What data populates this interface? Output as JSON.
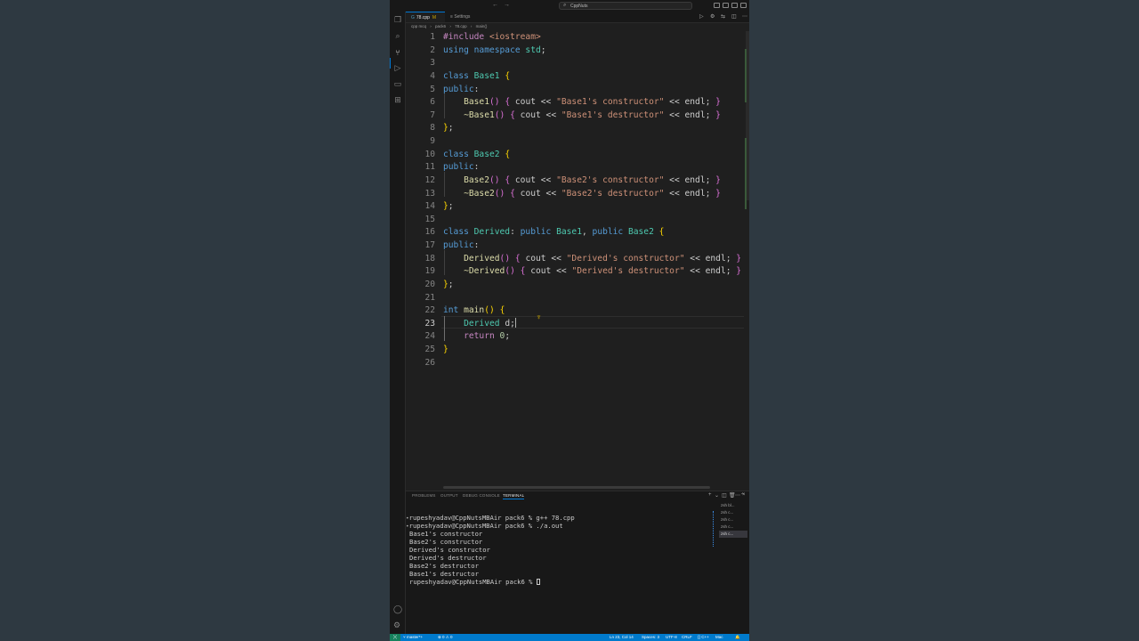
{
  "window": {
    "title": "CppNuts"
  },
  "tabs": [
    {
      "label": "78.cpp",
      "modified": "M",
      "active": true
    },
    {
      "label": "Settings",
      "active": false
    }
  ],
  "breadcrumb": [
    "cpp mcq",
    "pack6",
    "78.cpp",
    "main()"
  ],
  "editor": {
    "current_line": 23,
    "lines": [
      {
        "n": "1",
        "t": [
          [
            "inc",
            "#include "
          ],
          [
            "str",
            "<iostream>"
          ]
        ]
      },
      {
        "n": "2",
        "t": [
          [
            "kw",
            "using "
          ],
          [
            "kw",
            "namespace "
          ],
          [
            "cls",
            "std"
          ],
          [
            "",
            "; "
          ]
        ]
      },
      {
        "n": "3",
        "t": []
      },
      {
        "n": "4",
        "t": [
          [
            "kw",
            "class "
          ],
          [
            "cls",
            "Base1 "
          ],
          [
            "br1",
            "{"
          ]
        ]
      },
      {
        "n": "5",
        "t": [
          [
            "kw",
            "public"
          ],
          [
            "",
            ":"
          ]
        ]
      },
      {
        "n": "6",
        "t": [
          [
            "",
            "    "
          ],
          [
            "fn",
            "Base1"
          ],
          [
            "br2",
            "()"
          ],
          [
            "",
            " "
          ],
          [
            "br2",
            "{"
          ],
          [
            "",
            " cout << "
          ],
          [
            "str",
            "\"Base1's constructor\""
          ],
          [
            "",
            " << endl; "
          ],
          [
            "br2",
            "}"
          ]
        ]
      },
      {
        "n": "7",
        "t": [
          [
            "",
            "    "
          ],
          [
            "fn",
            "~Base1"
          ],
          [
            "br2",
            "()"
          ],
          [
            "",
            " "
          ],
          [
            "br2",
            "{"
          ],
          [
            "",
            " cout << "
          ],
          [
            "str",
            "\"Base1's destructor\""
          ],
          [
            "",
            " << endl; "
          ],
          [
            "br2",
            "}"
          ]
        ]
      },
      {
        "n": "8",
        "t": [
          [
            "br1",
            "}"
          ],
          [
            "",
            ";"
          ]
        ]
      },
      {
        "n": "9",
        "t": []
      },
      {
        "n": "10",
        "t": [
          [
            "kw",
            "class "
          ],
          [
            "cls",
            "Base2 "
          ],
          [
            "br1",
            "{"
          ]
        ]
      },
      {
        "n": "11",
        "t": [
          [
            "kw",
            "public"
          ],
          [
            "",
            ":"
          ]
        ]
      },
      {
        "n": "12",
        "t": [
          [
            "",
            "    "
          ],
          [
            "fn",
            "Base2"
          ],
          [
            "br2",
            "()"
          ],
          [
            "",
            " "
          ],
          [
            "br2",
            "{"
          ],
          [
            "",
            " cout << "
          ],
          [
            "str",
            "\"Base2's constructor\""
          ],
          [
            "",
            " << endl; "
          ],
          [
            "br2",
            "}"
          ]
        ]
      },
      {
        "n": "13",
        "t": [
          [
            "",
            "    "
          ],
          [
            "fn",
            "~Base2"
          ],
          [
            "br2",
            "()"
          ],
          [
            "",
            " "
          ],
          [
            "br2",
            "{"
          ],
          [
            "",
            " cout << "
          ],
          [
            "str",
            "\"Base2's destructor\""
          ],
          [
            "",
            " << endl; "
          ],
          [
            "br2",
            "}"
          ]
        ]
      },
      {
        "n": "14",
        "t": [
          [
            "br1",
            "}"
          ],
          [
            "",
            ";"
          ]
        ]
      },
      {
        "n": "15",
        "t": []
      },
      {
        "n": "16",
        "t": [
          [
            "kw",
            "class "
          ],
          [
            "cls",
            "Derived"
          ],
          [
            "",
            ": "
          ],
          [
            "kw",
            "public "
          ],
          [
            "cls",
            "Base1"
          ],
          [
            "",
            ", "
          ],
          [
            "kw",
            "public "
          ],
          [
            "cls",
            "Base2 "
          ],
          [
            "br1",
            "{"
          ]
        ]
      },
      {
        "n": "17",
        "t": [
          [
            "kw",
            "public"
          ],
          [
            "",
            ":"
          ]
        ]
      },
      {
        "n": "18",
        "t": [
          [
            "",
            "    "
          ],
          [
            "fn",
            "Derived"
          ],
          [
            "br2",
            "()"
          ],
          [
            "",
            " "
          ],
          [
            "br2",
            "{"
          ],
          [
            "",
            " cout << "
          ],
          [
            "str",
            "\"Derived's constructor\""
          ],
          [
            "",
            " << endl; "
          ],
          [
            "br2",
            "}"
          ]
        ]
      },
      {
        "n": "19",
        "t": [
          [
            "",
            "    "
          ],
          [
            "fn",
            "~Derived"
          ],
          [
            "br2",
            "()"
          ],
          [
            "",
            " "
          ],
          [
            "br2",
            "{"
          ],
          [
            "",
            " cout << "
          ],
          [
            "str",
            "\"Derived's destructor\""
          ],
          [
            "",
            " << endl; "
          ],
          [
            "br2",
            "}"
          ]
        ]
      },
      {
        "n": "20",
        "t": [
          [
            "br1",
            "}"
          ],
          [
            "",
            ";"
          ]
        ]
      },
      {
        "n": "21",
        "t": []
      },
      {
        "n": "22",
        "t": [
          [
            "kw",
            "int "
          ],
          [
            "fn",
            "main"
          ],
          [
            "br1",
            "()"
          ],
          [
            "",
            " "
          ],
          [
            "br1",
            "{"
          ]
        ]
      },
      {
        "n": "23",
        "t": [
          [
            "",
            "    "
          ],
          [
            "cls",
            "Derived "
          ],
          [
            "",
            "d;"
          ]
        ]
      },
      {
        "n": "24",
        "t": [
          [
            "",
            "    "
          ],
          [
            "kw2",
            "return "
          ],
          [
            "num",
            "0"
          ],
          [
            "",
            ";"
          ]
        ]
      },
      {
        "n": "25",
        "t": [
          [
            "br1",
            "}"
          ]
        ]
      },
      {
        "n": "26",
        "t": []
      }
    ]
  },
  "panel": {
    "tabs": [
      "PROBLEMS",
      "OUTPUT",
      "DEBUG CONSOLE",
      "TERMINAL"
    ],
    "active_tab": "TERMINAL",
    "terminal_lines": [
      {
        "prompt": true,
        "text": "rupeshyadav@CppNutsMBAir pack6 % g++ 78.cpp"
      },
      {
        "prompt": true,
        "text": "rupeshyadav@CppNutsMBAir pack6 % ./a.out"
      },
      {
        "prompt": false,
        "text": "Base1's constructor"
      },
      {
        "prompt": false,
        "text": "Base2's constructor"
      },
      {
        "prompt": false,
        "text": "Derived's constructor"
      },
      {
        "prompt": false,
        "text": "Derived's destructor"
      },
      {
        "prompt": false,
        "text": "Base2's destructor"
      },
      {
        "prompt": false,
        "text": "Base1's destructor"
      },
      {
        "prompt": false,
        "text": "rupeshyadav@CppNutsMBAir pack6 % "
      }
    ],
    "terminal_list": [
      "zsh bl...",
      "zsh c...",
      "zsh c...",
      "zsh c...",
      "zsh c..."
    ]
  },
  "statusbar": {
    "branch": "master*+",
    "errors": "⊗ 0 ⚠ 0",
    "position": "Ln 23, Col 14",
    "spaces": "Spaces: 3",
    "encoding": "UTF-8",
    "eol": "CRLF",
    "language": "{} C++",
    "platform": "Mac"
  },
  "colors": {
    "accent": "#0078d4",
    "statusbar": "#007acc",
    "editor_bg": "#1f1f1f"
  }
}
